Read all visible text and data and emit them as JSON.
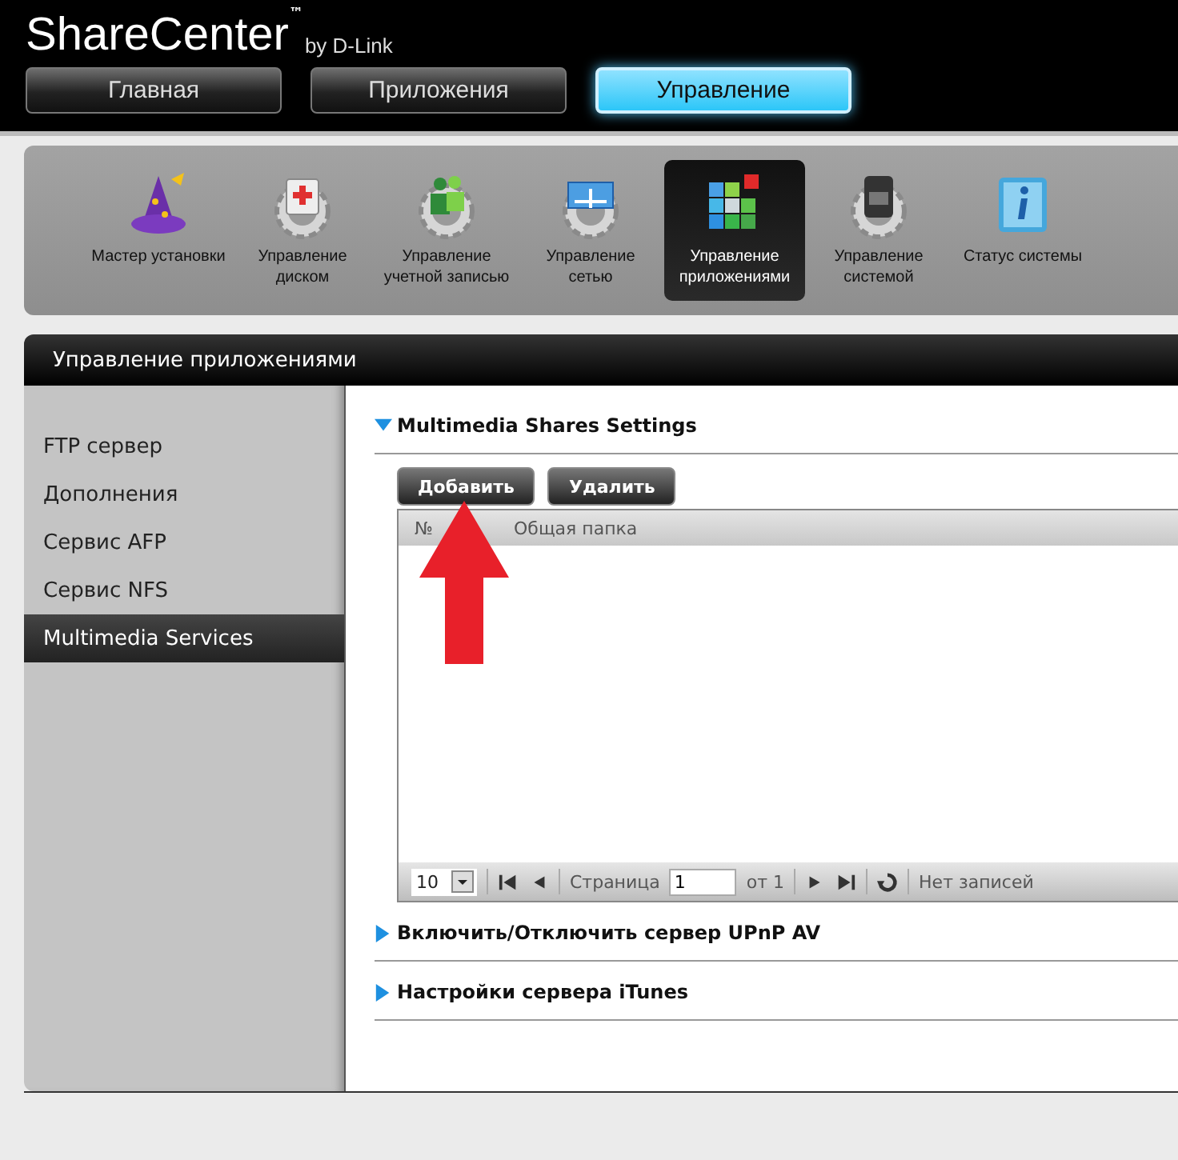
{
  "brand": {
    "name": "ShareCenter",
    "tm": "™",
    "by": "by D-Link"
  },
  "tabs": [
    {
      "label": "Главная",
      "selected": false
    },
    {
      "label": "Приложения",
      "selected": false
    },
    {
      "label": "Управление",
      "selected": true
    }
  ],
  "tools": [
    {
      "kind": "wizard",
      "label": "Мастер установки",
      "selected": false
    },
    {
      "kind": "disk",
      "label": "Управление диском",
      "selected": false
    },
    {
      "kind": "account",
      "label": "Управление учетной записью",
      "selected": false
    },
    {
      "kind": "network",
      "label": "Управление сетью",
      "selected": false
    },
    {
      "kind": "apps",
      "label": "Управление приложениями",
      "selected": true
    },
    {
      "kind": "system",
      "label": "Управление системой",
      "selected": false
    },
    {
      "kind": "status",
      "label": "Статус системы",
      "selected": false
    }
  ],
  "panel": {
    "title": "Управление приложениями"
  },
  "sidebar": {
    "items": [
      {
        "label": "FTP сервер",
        "selected": false
      },
      {
        "label": "Дополнения",
        "selected": false
      },
      {
        "label": "Сервис AFP",
        "selected": false
      },
      {
        "label": "Сервис NFS",
        "selected": false
      },
      {
        "label": "Multimedia Services",
        "selected": true
      }
    ]
  },
  "sections": [
    {
      "title": "Multimedia Shares Settings",
      "expanded": true,
      "buttons": [
        "Добавить",
        "Удалить"
      ],
      "table": {
        "columns": [
          "№",
          "Общая папка"
        ],
        "pager": {
          "page_size": "10",
          "page_label": "Страница",
          "page": "1",
          "of": "от 1",
          "status": "Нет записей"
        }
      }
    },
    {
      "title": "Включить/Отключить сервер UPnP AV",
      "expanded": false
    },
    {
      "title": "Настройки сервера iTunes",
      "expanded": false
    }
  ],
  "annotation": {
    "kind": "arrow"
  }
}
